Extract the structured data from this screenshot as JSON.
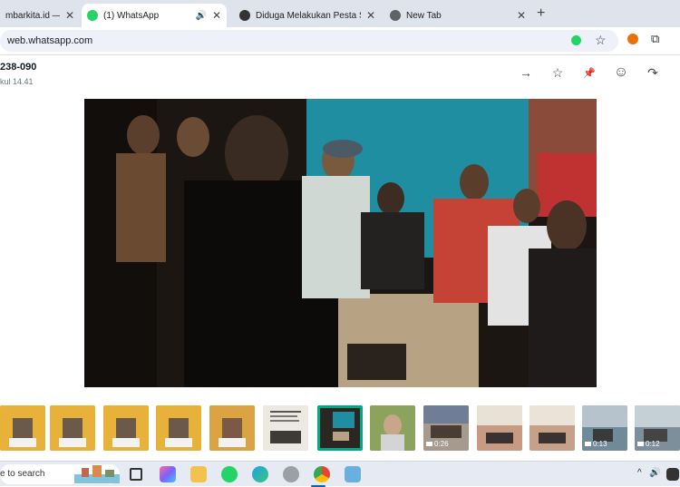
{
  "browser": {
    "tabs": [
      {
        "label": "mbarkita.id — Wo",
        "close": "✕",
        "icon": "globe-icon"
      },
      {
        "label": "(1) WhatsApp",
        "close": "✕",
        "icon": "whatsapp-icon",
        "audio": "🔊"
      },
      {
        "label": "Diduga Melakukan Pesta Sabu -",
        "close": "✕",
        "icon": "site-icon"
      },
      {
        "label": "New Tab",
        "close": "✕",
        "icon": "chrome-icon"
      }
    ],
    "new_tab": "+",
    "url": "web.whatsapp.com",
    "bookmark_star": "☆",
    "extensions": "⧉"
  },
  "viewer": {
    "contact": "238-090",
    "time": "kul 14.41",
    "actions": [
      {
        "name": "forward-icon",
        "glyph": "→"
      },
      {
        "name": "star-icon",
        "glyph": "☆"
      },
      {
        "name": "pin-icon",
        "glyph": "📌"
      },
      {
        "name": "emoji-icon",
        "glyph": "☺"
      },
      {
        "name": "share-icon",
        "glyph": "↷"
      }
    ]
  },
  "thumbnails": [
    {
      "type": "image",
      "color": "#e8b23a"
    },
    {
      "type": "image",
      "color": "#e8b23a"
    },
    {
      "type": "image",
      "color": "#e8b23a"
    },
    {
      "type": "image",
      "color": "#e8b23a"
    },
    {
      "type": "image",
      "color": "#d9a441"
    },
    {
      "type": "image",
      "color": "#ece9e2"
    },
    {
      "type": "video",
      "color": "#2b2622",
      "selected": true
    },
    {
      "type": "image",
      "color": "#8ca35e"
    },
    {
      "type": "video",
      "color": "#a69a8e",
      "duration": "0:26"
    },
    {
      "type": "image",
      "color": "#c79b82"
    },
    {
      "type": "image",
      "color": "#c7a08a"
    },
    {
      "type": "video",
      "color": "#6f8a99",
      "duration": "0:13"
    },
    {
      "type": "video",
      "color": "#7d8f9a",
      "duration": "0:12"
    }
  ],
  "taskbar": {
    "search_text": "e to search",
    "tray_chevron": "^",
    "tray_volume": "🔊"
  }
}
